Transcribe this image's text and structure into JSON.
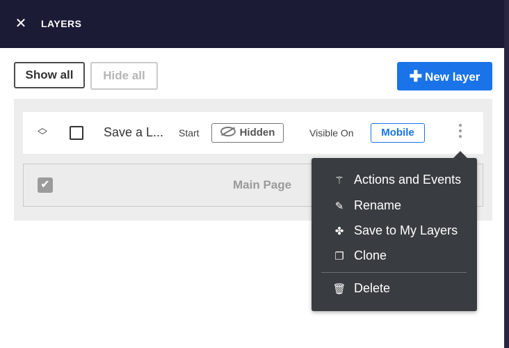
{
  "header": {
    "title": "LAYERS",
    "close_icon": "close-icon"
  },
  "toolbar": {
    "show_all": "Show all",
    "hide_all": "Hide all",
    "new_layer": "New layer",
    "new_layer_icon": "plus-icon",
    "accent_color": "#1a73e8"
  },
  "layers": [
    {
      "name": "Save a L...",
      "start_label": "Start",
      "visibility_label": "Hidden",
      "visible_on_label": "Visible On",
      "device": "Mobile",
      "checked": false
    },
    {
      "name": "Main Page",
      "checked": true,
      "disabled": true
    }
  ],
  "context_menu": {
    "items": [
      {
        "label": "Actions and Events",
        "icon": "magic-wand-icon"
      },
      {
        "label": "Rename",
        "icon": "pencil-icon"
      },
      {
        "label": "Save to My Layers",
        "icon": "puzzle-icon"
      },
      {
        "label": "Clone",
        "icon": "clone-icon"
      },
      {
        "label": "Delete",
        "icon": "trash-icon"
      }
    ]
  }
}
